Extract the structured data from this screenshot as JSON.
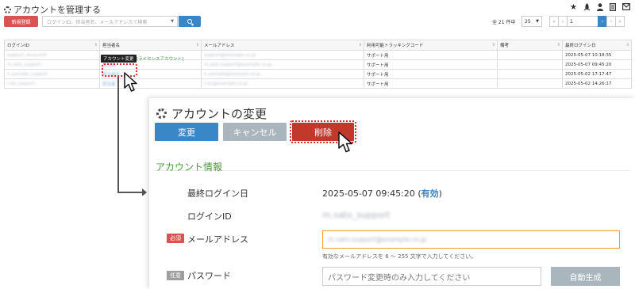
{
  "page": {
    "title": "アカウントを管理する",
    "top_icons": [
      "star-icon",
      "rocket-icon",
      "user-icon",
      "document-icon",
      "mail-icon"
    ]
  },
  "toolbar": {
    "new_button": "新規登録",
    "search_placeholder": "ログインID、担当者名、メールアドレスで検索",
    "total": "全 21 件中",
    "per_page": "25",
    "page_input": "1"
  },
  "table": {
    "headers": [
      "ログインID",
      "担当者名",
      "メールアドレス",
      "利用可能トラッキングコード",
      "備考",
      "最終ログイン日"
    ],
    "rows": [
      {
        "login": "support_account0",
        "name": "",
        "email": "support@example.co.jp",
        "code": "サポート用",
        "note": "",
        "last_login": "2025-05-07 10:18:35"
      },
      {
        "login": "m.sato_support",
        "name": "担当者",
        "email": "m.sato.support@example.co.jp",
        "code": "サポート用",
        "note": "",
        "last_login": "2025-05-07 09:45:20"
      },
      {
        "login": "k.yamada_support",
        "name": "担当者名",
        "email": "k.yamada@example.co.jp",
        "code": "サポート用",
        "note": "",
        "last_login": "2025-05-02 17:17:47"
      },
      {
        "login": "t.ito_support",
        "name": "担当者",
        "email": "t.ito@example.co.jp",
        "code": "サポート用",
        "note": "",
        "last_login": "2025-05-02 14:26:17"
      }
    ],
    "tooltip": "アカウント変更",
    "license_label": "[ライセンスアカウント]"
  },
  "panel": {
    "title": "アカウントの変更",
    "change_button": "変更",
    "cancel_button": "キャンセル",
    "delete_button": "削除",
    "section_title": "アカウント情報",
    "last_login_label": "最終ログイン日",
    "last_login_value": "2025-05-07 09:45:20",
    "status_open": "(",
    "status_valid": "有効",
    "status_close": ")",
    "login_id_label": "ログインID",
    "login_id_value": "m.sato_support",
    "required_badge": "必須",
    "email_label": "メールアドレス",
    "email_value": "m.sato.support@example.co.jp",
    "email_help": "有効なメールアドレスを 6 ～ 255 文字で入力してください。",
    "optional_badge": "任意",
    "password_label": "パスワード",
    "password_placeholder": "パスワード変更時のみ入力してください",
    "generate_button": "自動生成"
  },
  "colors": {
    "primary": "#3a87c8",
    "danger": "#d9534f",
    "delete": "#c0392b",
    "secondary": "#aab6bd",
    "section": "#4a9a3a",
    "highlight": "#d32f2f"
  }
}
